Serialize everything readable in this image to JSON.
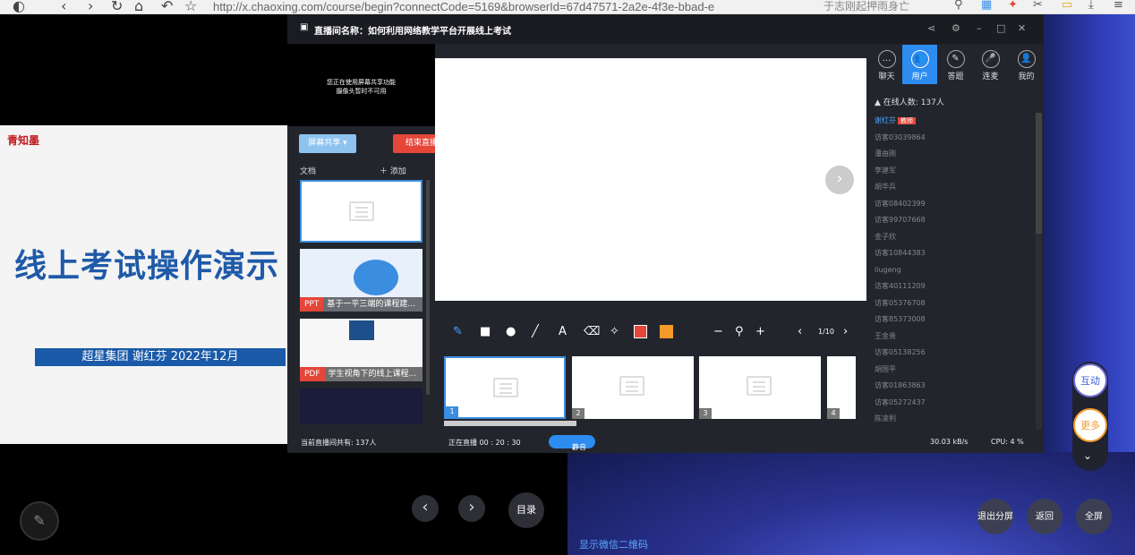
{
  "browser": {
    "url": "http://x.chaoxing.com/course/begin?connectCode=5169&browserId=67d47571-2a2e-4f3e-bbad-e",
    "search_text": "于志刚起押雨身亡"
  },
  "slide": {
    "logo": "青知墨",
    "title": "线上考试操作演示",
    "author_line": "超星集团   谢红芬    2022年12月"
  },
  "nav": {
    "catalog_label": "目录"
  },
  "live": {
    "title": "直播间名称：如何利用网络教学平台开展线上考试",
    "camera_msg_line1": "您正在使用屏幕共享功能",
    "camera_msg_line2": "摄像头暂时不可用",
    "share_label": "屏幕共享 ▾",
    "end_label": "结束直播",
    "docs_label": "文档",
    "add_label": "＋ 添加",
    "docs": [
      {
        "type": "",
        "name": ""
      },
      {
        "type": "PPT",
        "name": "基于一平三端的课程建..."
      },
      {
        "type": "PDF",
        "name": "学生视角下的线上课程..."
      }
    ],
    "page_indicator": "1/10",
    "slide_numbers": [
      "1",
      "2",
      "3",
      "4"
    ],
    "tabs": [
      {
        "label": "聊天",
        "icon": "chat-icon"
      },
      {
        "label": "用户",
        "icon": "users-icon"
      },
      {
        "label": "答题",
        "icon": "pen-icon"
      },
      {
        "label": "连麦",
        "icon": "mic-icon"
      },
      {
        "label": "我的",
        "icon": "person-icon"
      }
    ],
    "online_count": "在线人数: 137人",
    "users": [
      {
        "name": "谢红芬",
        "tag": "教师"
      },
      {
        "name": "访客03039864",
        "tag": ""
      },
      {
        "name": "潘由刚",
        "tag": ""
      },
      {
        "name": "李建军",
        "tag": ""
      },
      {
        "name": "胡华兵",
        "tag": ""
      },
      {
        "name": "访客08402399",
        "tag": ""
      },
      {
        "name": "访客99707668",
        "tag": ""
      },
      {
        "name": "金子欣",
        "tag": ""
      },
      {
        "name": "访客10844383",
        "tag": ""
      },
      {
        "name": "liugeng",
        "tag": ""
      },
      {
        "name": "访客40111209",
        "tag": ""
      },
      {
        "name": "访客05376708",
        "tag": ""
      },
      {
        "name": "访客85373008",
        "tag": ""
      },
      {
        "name": "王金贵",
        "tag": ""
      },
      {
        "name": "访客05138256",
        "tag": ""
      },
      {
        "name": "胡国平",
        "tag": ""
      },
      {
        "name": "访客01863863",
        "tag": ""
      },
      {
        "name": "访客05272437",
        "tag": ""
      },
      {
        "name": "陈凌利",
        "tag": ""
      }
    ],
    "status_total": "当前直播间共有: 137人",
    "status_live": "正在直播 00 : 20 : 30",
    "mute_label": "静音",
    "net_speed": "30.03 kB/s",
    "cpu": "CPU:  4 %"
  },
  "right": {
    "interact_label": "互动",
    "more_label": "更多",
    "exit_split_label": "退出分屏",
    "back_label": "返回",
    "fullscreen_label": "全屏",
    "wechat_qr_label": "显示微信二维码"
  },
  "colors": {
    "accent_blue": "#2d8cf0",
    "end_red": "#e4463a",
    "pen_red": "#e4463a",
    "pen_orange": "#f39a2b"
  }
}
